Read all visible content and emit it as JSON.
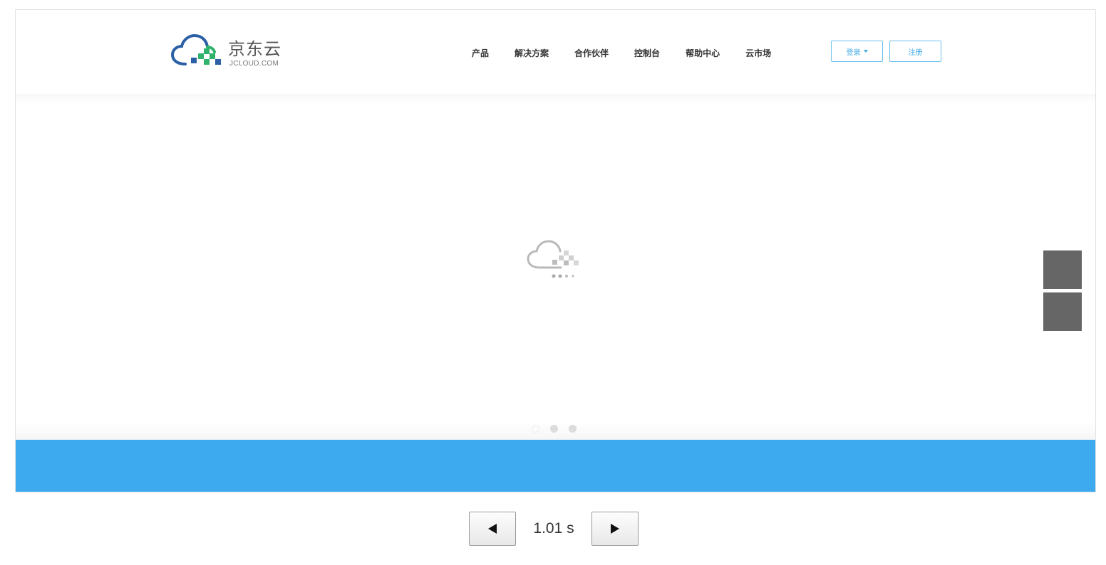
{
  "header": {
    "logo": {
      "name_cn": "京东云",
      "domain": "JCLOUD.COM",
      "icon": "jdcloud-logo-icon"
    },
    "nav": [
      "产品",
      "解决方案",
      "合作伙伴",
      "控制台",
      "帮助中心",
      "云市场"
    ],
    "login_label": "登录",
    "register_label": "注册"
  },
  "banner": {
    "loader_icon": "cloud-loading-icon",
    "carousel_dots": 3,
    "active_dot": 0
  },
  "side_tools": [
    "side-button-1",
    "side-button-2"
  ],
  "player": {
    "prev_icon": "triangle-left-icon",
    "next_icon": "triangle-right-icon",
    "time": "1.01 s"
  },
  "colors": {
    "accent_blue": "#3da9ee",
    "button_border": "#6cc1ef",
    "side_button": "#666666",
    "logo_green": "#2fb36b",
    "logo_blue": "#2b5fa6"
  }
}
